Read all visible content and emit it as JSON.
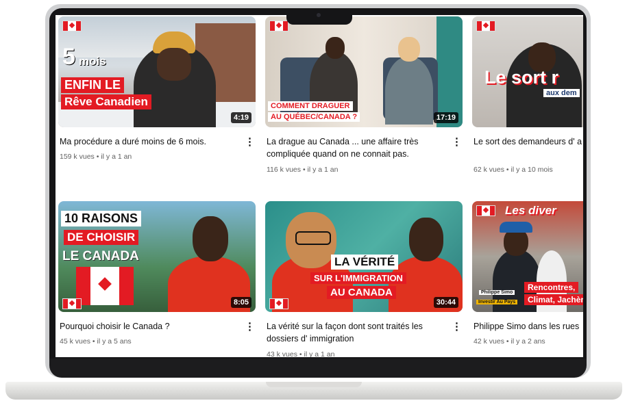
{
  "videos": [
    {
      "title": "Ma procédure a duré moins de 6 mois.",
      "views": "159 k vues",
      "age": "il y a 1 an",
      "duration": "4:19",
      "thumb_text": [
        "5",
        "mois",
        "ENFIN LE",
        "Rêve Canadien"
      ]
    },
    {
      "title": "La drague au Canada ... une affaire très compliquée quand on ne connait pas.",
      "views": "116 k vues",
      "age": "il y a 1 an",
      "duration": "17:19",
      "thumb_text": [
        "COMMENT DRAGUER",
        "AU QUÉBEC/CANADA ?"
      ]
    },
    {
      "title": "Le sort des demandeurs d' a Canada ...",
      "views": "62 k vues",
      "age": "il y a 10 mois",
      "duration": "",
      "thumb_text": [
        "Le sort r",
        "aux dem"
      ]
    },
    {
      "title": "Pourquoi choisir le Canada ?",
      "views": "45 k vues",
      "age": "il y a 5 ans",
      "duration": "8:05",
      "thumb_text": [
        "10 RAISONS",
        "DE CHOISIR",
        "LE CANADA"
      ]
    },
    {
      "title": "La vérité sur la façon dont sont traités les dossiers d' immigration",
      "views": "43 k vues",
      "age": "il y a 1 an",
      "duration": "30:44",
      "thumb_text": [
        "LA VÉRITÉ",
        "SUR L'IMMIGRATION",
        "AU CANADA"
      ]
    },
    {
      "title": "Philippe Simo dans les rues",
      "views": "42 k vues",
      "age": "il y a 2 ans",
      "duration": "",
      "thumb_text": [
        "Les diver",
        "Rencontres,",
        "Climat, Jachère",
        "Philippe Simo",
        "Investir Au Pays"
      ]
    }
  ],
  "meta_separator": "•",
  "more_glyph": "⋮",
  "colors": {
    "canada_red": "#e31b23",
    "title_text": "#0f0f0f",
    "meta_text": "#606060"
  }
}
